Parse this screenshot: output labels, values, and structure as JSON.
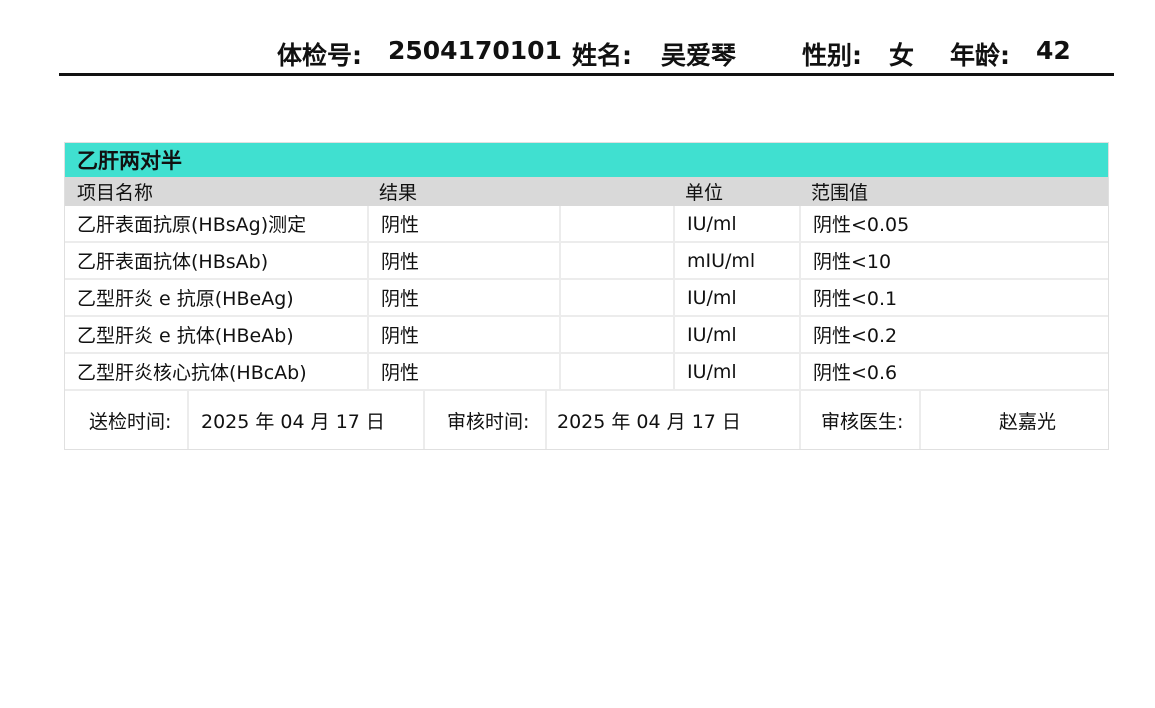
{
  "header": {
    "exam_no_label": "体检号:",
    "exam_no": "2504170101",
    "name_label": "姓名:",
    "name": "吴爱琴",
    "gender_label": "性别:",
    "gender": "女",
    "age_label": "年龄:",
    "age": "42"
  },
  "section": {
    "title": "乙肝两对半",
    "columns": [
      "项目名称",
      "结果",
      "单位",
      "范围值"
    ],
    "rows": [
      {
        "item": "乙肝表面抗原(HBsAg)测定",
        "result": "阴性",
        "unit": "IU/ml",
        "range": "阴性<0.05"
      },
      {
        "item": "乙肝表面抗体(HBsAb)",
        "result": "阴性",
        "unit": "mIU/ml",
        "range": "阴性<10"
      },
      {
        "item": "乙型肝炎 e 抗原(HBeAg)",
        "result": "阴性",
        "unit": "IU/ml",
        "range": "阴性<0.1"
      },
      {
        "item": "乙型肝炎 e 抗体(HBeAb)",
        "result": "阴性",
        "unit": "IU/ml",
        "range": "阴性<0.2"
      },
      {
        "item": "乙型肝炎核心抗体(HBcAb)",
        "result": "阴性",
        "unit": "IU/ml",
        "range": "阴性<0.6"
      }
    ]
  },
  "footer": {
    "submit_label": "送检时间:",
    "submit_date": "2025 年 04 月 17 日",
    "review_label": "审核时间:",
    "review_date": "2025 年 04 月 17 日",
    "doctor_label": "审核医生:",
    "doctor": "赵嘉光"
  }
}
